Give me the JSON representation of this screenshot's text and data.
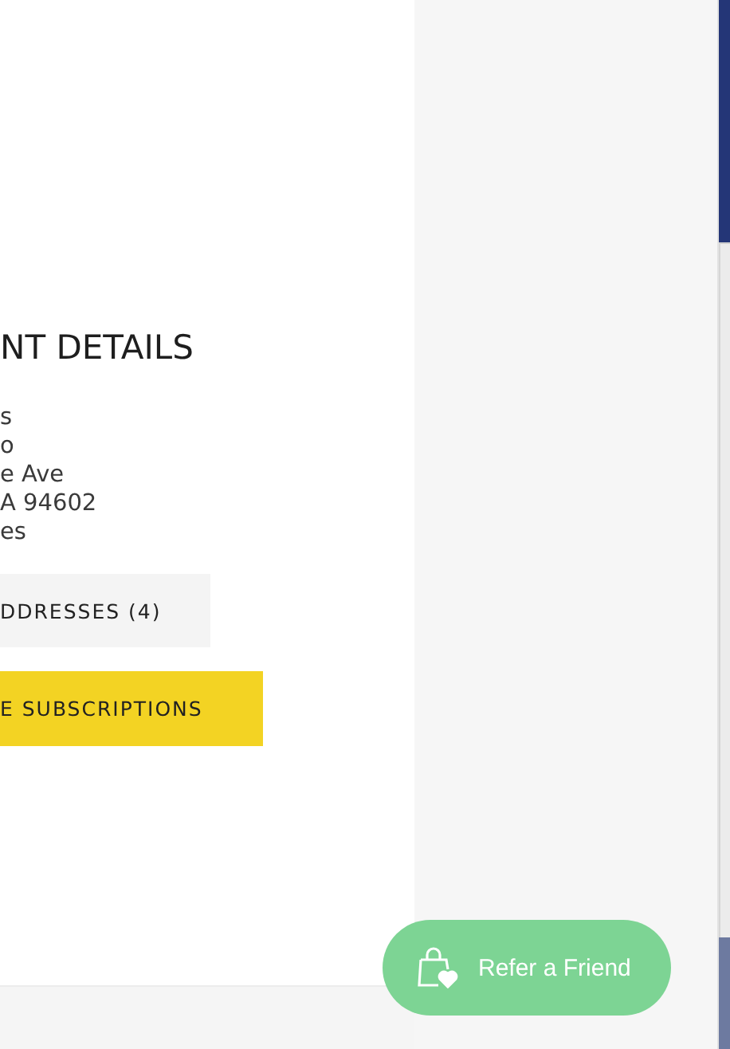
{
  "account": {
    "heading": "NT DETAILS",
    "address_lines": [
      "s",
      "o",
      "e Ave",
      "A 94602",
      "es"
    ],
    "buttons": [
      {
        "label": "DDRESSES (4)",
        "kind": "secondary"
      },
      {
        "label": "E SUBSCRIPTIONS",
        "kind": "primary"
      }
    ]
  },
  "refer_button": {
    "label": "Refer a Friend"
  }
}
